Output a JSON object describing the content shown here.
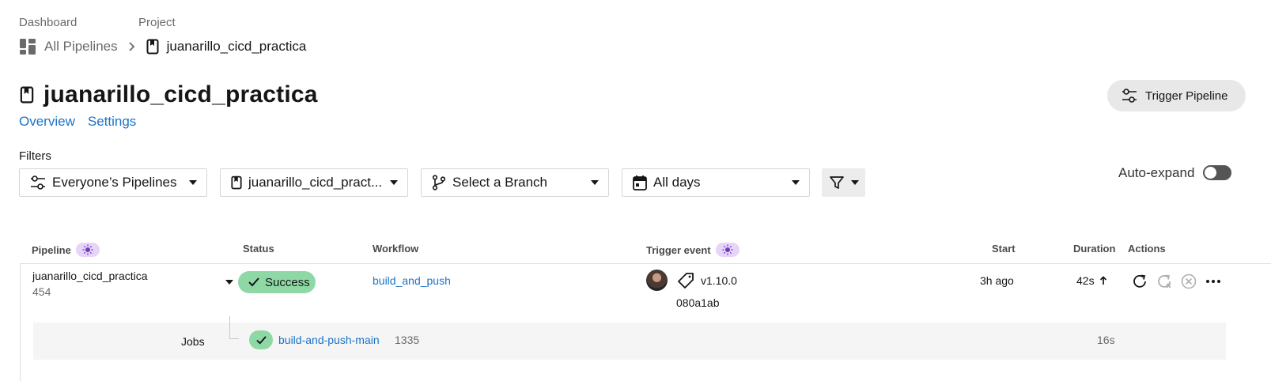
{
  "breadcrumb": {
    "dashboard_label": "Dashboard",
    "project_label": "Project",
    "all_pipelines": "All Pipelines",
    "project_name": "juanarillo_cicd_practica"
  },
  "page": {
    "title": "juanarillo_cicd_practica",
    "tabs": [
      "Overview",
      "Settings"
    ],
    "trigger_button": "Trigger Pipeline"
  },
  "filters": {
    "label": "Filters",
    "pipelines": "Everyone’s Pipelines",
    "project": "juanarillo_cicd_pract...",
    "branch": "Select a Branch",
    "days": "All days",
    "auto_expand_label": "Auto-expand",
    "auto_expand_on": false
  },
  "table": {
    "headers": {
      "pipeline": "Pipeline",
      "status": "Status",
      "workflow": "Workflow",
      "trigger_event": "Trigger event",
      "start": "Start",
      "duration": "Duration",
      "actions": "Actions"
    },
    "rows": [
      {
        "pipeline_name": "juanarillo_cicd_practica",
        "pipeline_number": "454",
        "status": "Success",
        "workflow": "build_and_push",
        "trigger_tag": "v1.10.0",
        "commit": "080a1ab",
        "start": "3h ago",
        "duration": "42s",
        "jobs_label": "Jobs",
        "jobs": [
          {
            "name": "build-and-push-main",
            "number": "1335",
            "duration": "16s"
          }
        ]
      }
    ]
  },
  "colors": {
    "accent_link": "#1b73c9",
    "success_badge": "#8ed8a6",
    "new_feature_badge": "#e6d5f7"
  },
  "icons": [
    "pipelines-grid-icon",
    "chevron-right-icon",
    "project-bookmark-icon",
    "sliders-icon",
    "branch-icon",
    "calendar-icon",
    "funnel-icon",
    "bulb-icon",
    "check-icon",
    "tag-icon",
    "arrow-up-icon",
    "rerun-icon",
    "rerun-failed-icon",
    "cancel-icon",
    "more-icon"
  ]
}
